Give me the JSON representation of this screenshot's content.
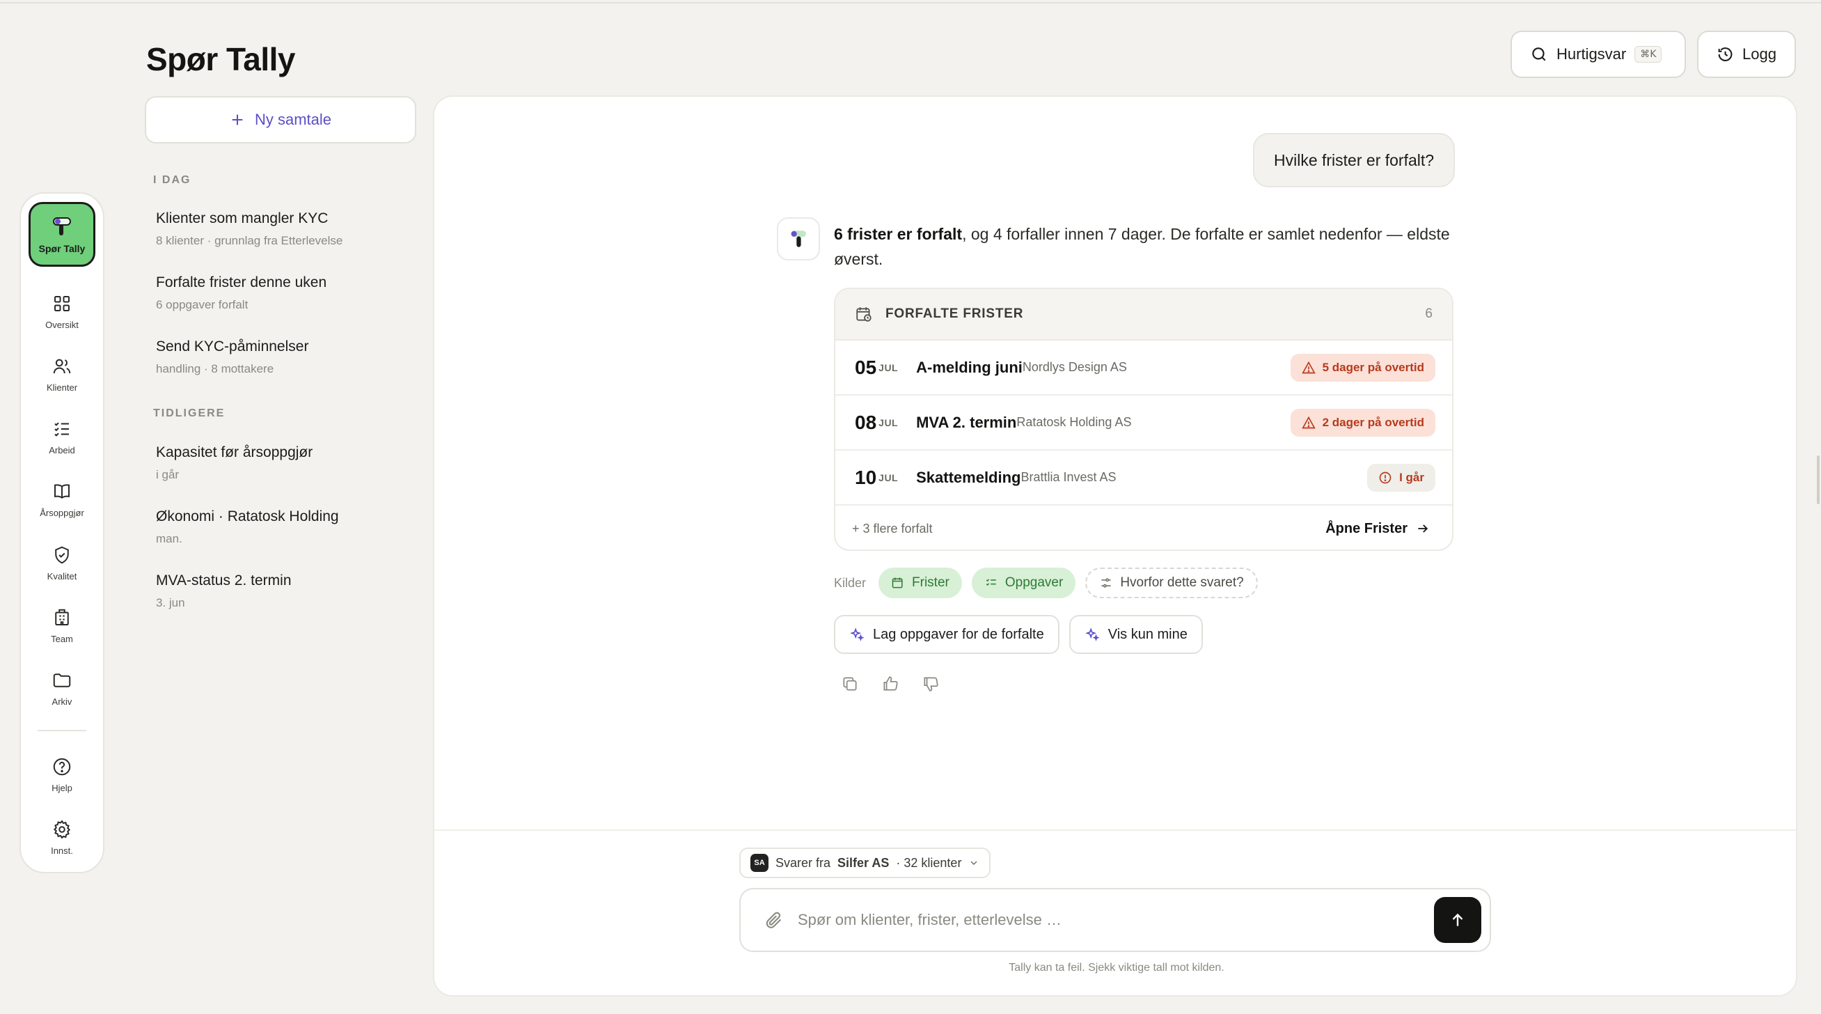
{
  "page": {
    "title": "Spør Tally"
  },
  "top_buttons": {
    "quick": "Hurtigsvar",
    "quick_kbd": "⌘K",
    "log": "Logg"
  },
  "rail": {
    "active": "Spør Tally",
    "items": [
      "Oversikt",
      "Klienter",
      "Arbeid",
      "Årsoppgjør",
      "Kvalitet",
      "Team",
      "Arkiv"
    ],
    "bottom": [
      "Hjelp",
      "Innst."
    ]
  },
  "sidebar": {
    "new_chat": "Ny samtale",
    "today_label": "I DAG",
    "earlier_label": "TIDLIGERE",
    "today": [
      {
        "title": "Klienter som mangler KYC",
        "sub": "8 klienter · grunnlag fra Etterlevelse"
      },
      {
        "title": "Forfalte frister denne uken",
        "sub": "6 oppgaver forfalt"
      },
      {
        "title": "Send KYC-påminnelser",
        "sub": "handling · 8 mottakere"
      }
    ],
    "earlier": [
      {
        "title": "Kapasitet før årsoppgjør",
        "sub": "i går"
      },
      {
        "title": "Økonomi · Ratatosk Holding",
        "sub": "man."
      },
      {
        "title": "MVA-status 2. termin",
        "sub": "3. jun"
      }
    ]
  },
  "chat": {
    "user_question": "Hvilke frister er forfalt?",
    "answer_bold": "6 frister er forfalt",
    "answer_rest": ", og 4 forfaller innen 7 dager. De forfalte er samlet nedenfor — eldste øverst.",
    "card": {
      "title": "FORFALTE FRISTER",
      "count": "6",
      "rows": [
        {
          "day": "05",
          "mon": "JUL",
          "title": "A-melding juni",
          "client": "Nordlys Design AS",
          "badge": "5 dager på overtid",
          "kind": "red"
        },
        {
          "day": "08",
          "mon": "JUL",
          "title": "MVA 2. termin",
          "client": "Ratatosk Holding AS",
          "badge": "2 dager på overtid",
          "kind": "red"
        },
        {
          "day": "10",
          "mon": "JUL",
          "title": "Skattemelding",
          "client": "Brattlia Invest AS",
          "badge": "I går",
          "kind": "grey"
        }
      ],
      "more": "+ 3 flere forfalt",
      "open": "Åpne Frister"
    },
    "sources_label": "Kilder",
    "sources": [
      "Frister",
      "Oppgaver"
    ],
    "why": "Hvorfor dette svaret?",
    "actions": [
      "Lag oppgaver for de forfalte",
      "Vis kun mine"
    ]
  },
  "composer": {
    "ctx_prefix": "Svarer fra",
    "ctx_initials": "SA",
    "ctx_org": "Silfer AS",
    "ctx_count": "· 32 klienter",
    "placeholder": "Spør om klienter, frister, etterlevelse …",
    "disclaimer": "Tally kan ta feil. Sjekk viktige tall mot kilden."
  },
  "colors": {
    "accent_green": "#6fcf7a",
    "accent_purple": "#5b4fc6",
    "overdue_red": "#b73a1e"
  }
}
